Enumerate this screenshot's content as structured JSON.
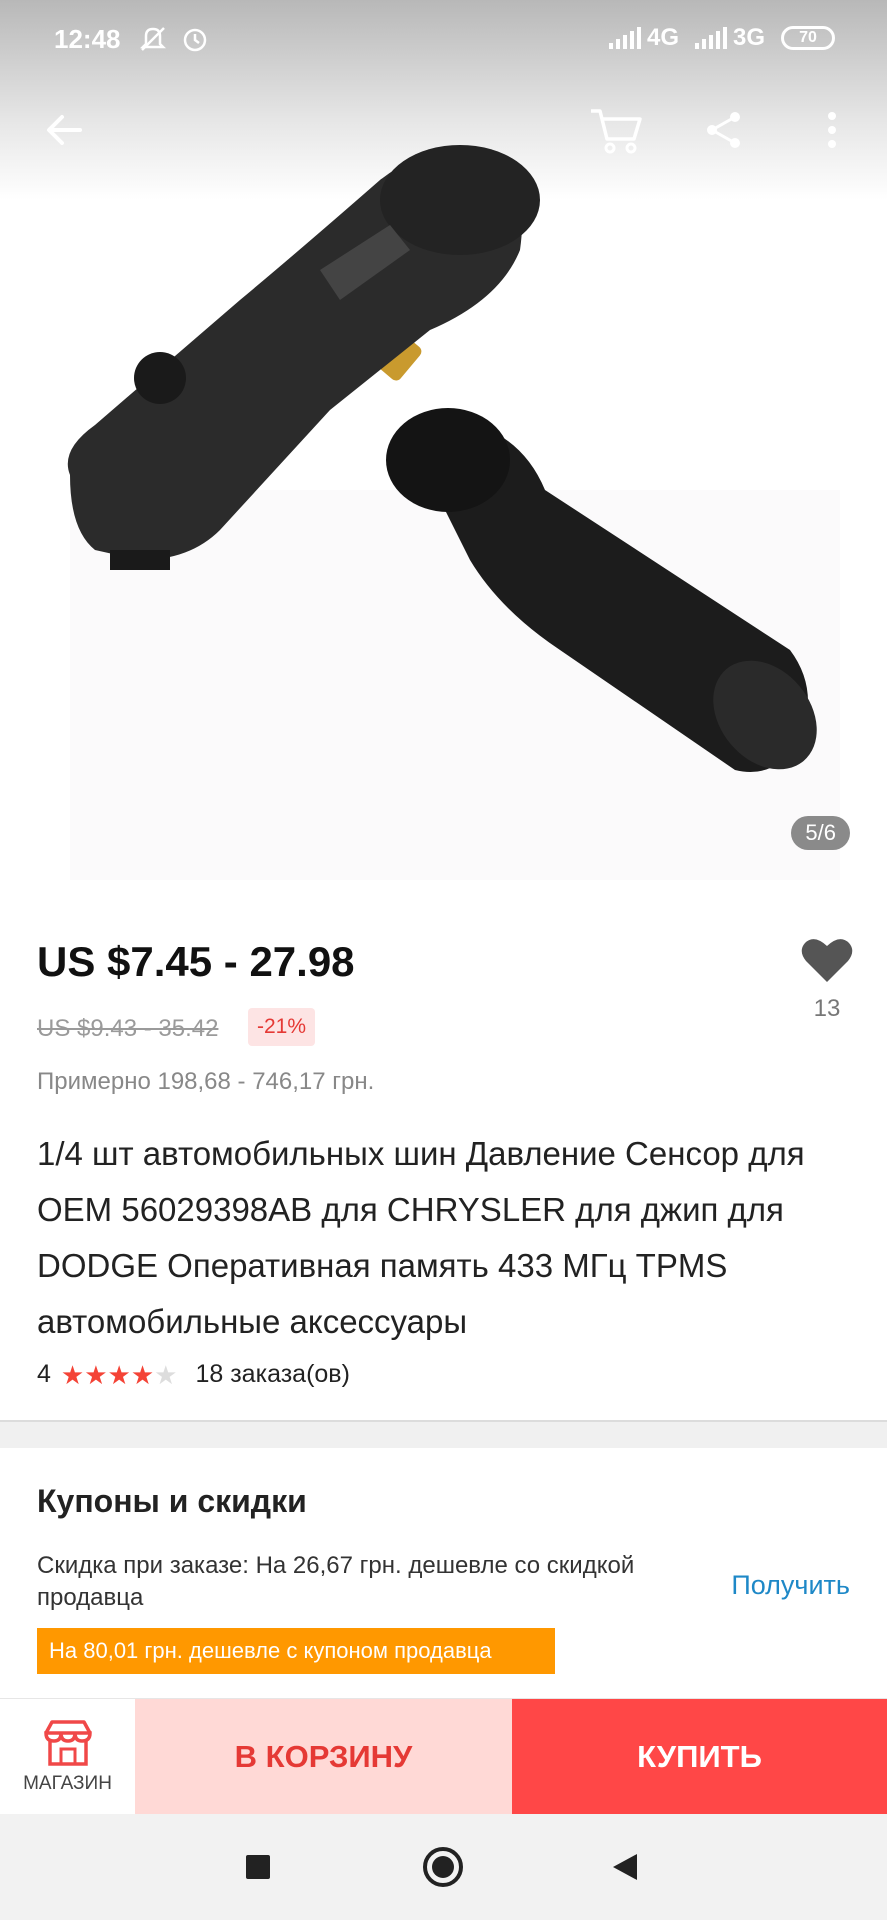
{
  "status_bar": {
    "time": "12:48",
    "network_1": "4G",
    "network_2": "3G",
    "battery": "70"
  },
  "gallery": {
    "pager": "5/6",
    "icons": [
      "back-arrow-icon",
      "cart-icon",
      "share-icon",
      "more-vertical-icon"
    ]
  },
  "product": {
    "price": "US $7.45 - 27.98",
    "old_price": "US $9.43 - 35.42",
    "discount": "-21%",
    "approx_price": "Примерно 198,68 - 746,17 грн.",
    "favorites_count": "13",
    "title": "1/4 шт автомобильных шин Давление Сенсор для OEM 56029398AB для CHRYSLER для джип для DODGE Оперативная память 433 МГц TPMS автомобильные аксессуары",
    "rating_value": "4",
    "rating_stars": 4,
    "orders": "18 заказа(ов)"
  },
  "coupons": {
    "title": "Купоны и скидки",
    "order_discount": "Скидка при заказе: На 26,67 грн. дешевле со скидкой продавца",
    "get_label": "Получить",
    "coupon_tag": "На 80,01 грн. дешевле с купоном продавца"
  },
  "actions": {
    "shop_label": "МАГАЗИН",
    "add_to_cart": "В КОРЗИНУ",
    "buy_now": "КУПИТЬ"
  },
  "colors": {
    "accent_red": "#ff4747",
    "cart_bg": "#ffd9d6",
    "coupon_orange": "#ff9800",
    "link_blue": "#1e88c7"
  }
}
